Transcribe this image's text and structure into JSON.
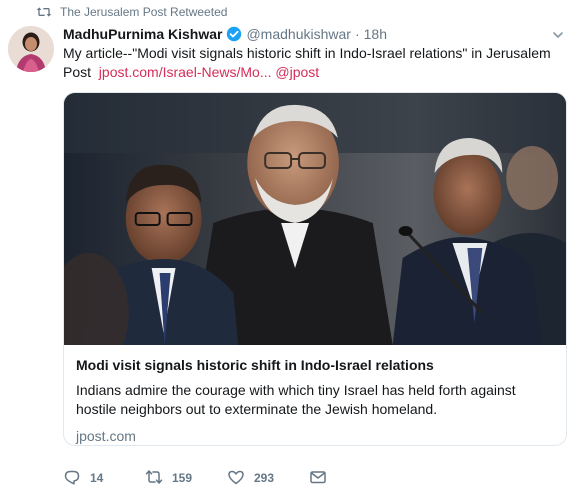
{
  "retweet_context": {
    "icon": "retweet-icon",
    "text": "The Jerusalem Post Retweeted"
  },
  "author": {
    "avatar": "avatar",
    "name": "MadhuPurnima Kishwar",
    "verified_icon": "verified-badge-icon",
    "handle": "@madhukishwar",
    "separator": "·",
    "time": "18h"
  },
  "tweet": {
    "text": "My article--\"Modi visit signals historic shift in Indo-Israel relations\" in Jerusalem Post",
    "link": "jpost.com/Israel-News/Mo...",
    "mention": "@jpost"
  },
  "card": {
    "title": "Modi visit signals historic shift in Indo-Israel relations",
    "description": "Indians admire the courage with which tiny Israel has held forth against hostile neighbors out to exterminate the Jewish homeland.",
    "domain": "jpost.com"
  },
  "actions": {
    "reply_count": "14",
    "retweet_count": "159",
    "like_count": "293"
  },
  "colors": {
    "link": "#d62d5a",
    "muted": "#657786",
    "verified": "#1da1f2"
  }
}
